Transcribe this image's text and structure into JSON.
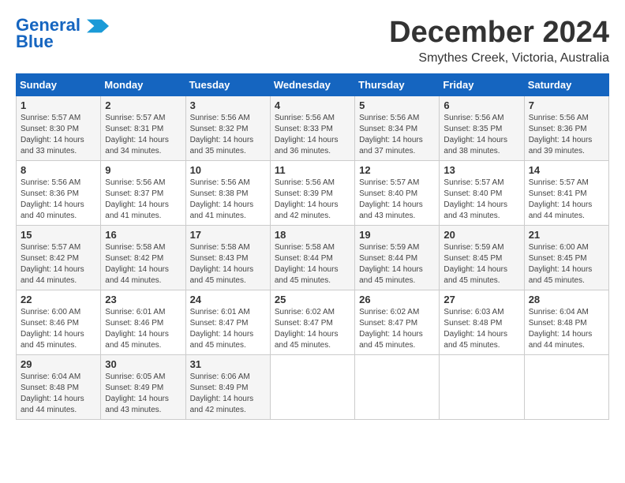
{
  "header": {
    "logo_line1": "General",
    "logo_line2": "Blue",
    "month": "December 2024",
    "location": "Smythes Creek, Victoria, Australia"
  },
  "weekdays": [
    "Sunday",
    "Monday",
    "Tuesday",
    "Wednesday",
    "Thursday",
    "Friday",
    "Saturday"
  ],
  "weeks": [
    [
      {
        "day": "1",
        "sunrise": "5:57 AM",
        "sunset": "8:30 PM",
        "daylight": "14 hours and 33 minutes."
      },
      {
        "day": "2",
        "sunrise": "5:57 AM",
        "sunset": "8:31 PM",
        "daylight": "14 hours and 34 minutes."
      },
      {
        "day": "3",
        "sunrise": "5:56 AM",
        "sunset": "8:32 PM",
        "daylight": "14 hours and 35 minutes."
      },
      {
        "day": "4",
        "sunrise": "5:56 AM",
        "sunset": "8:33 PM",
        "daylight": "14 hours and 36 minutes."
      },
      {
        "day": "5",
        "sunrise": "5:56 AM",
        "sunset": "8:34 PM",
        "daylight": "14 hours and 37 minutes."
      },
      {
        "day": "6",
        "sunrise": "5:56 AM",
        "sunset": "8:35 PM",
        "daylight": "14 hours and 38 minutes."
      },
      {
        "day": "7",
        "sunrise": "5:56 AM",
        "sunset": "8:36 PM",
        "daylight": "14 hours and 39 minutes."
      }
    ],
    [
      {
        "day": "8",
        "sunrise": "5:56 AM",
        "sunset": "8:36 PM",
        "daylight": "14 hours and 40 minutes."
      },
      {
        "day": "9",
        "sunrise": "5:56 AM",
        "sunset": "8:37 PM",
        "daylight": "14 hours and 41 minutes."
      },
      {
        "day": "10",
        "sunrise": "5:56 AM",
        "sunset": "8:38 PM",
        "daylight": "14 hours and 41 minutes."
      },
      {
        "day": "11",
        "sunrise": "5:56 AM",
        "sunset": "8:39 PM",
        "daylight": "14 hours and 42 minutes."
      },
      {
        "day": "12",
        "sunrise": "5:57 AM",
        "sunset": "8:40 PM",
        "daylight": "14 hours and 43 minutes."
      },
      {
        "day": "13",
        "sunrise": "5:57 AM",
        "sunset": "8:40 PM",
        "daylight": "14 hours and 43 minutes."
      },
      {
        "day": "14",
        "sunrise": "5:57 AM",
        "sunset": "8:41 PM",
        "daylight": "14 hours and 44 minutes."
      }
    ],
    [
      {
        "day": "15",
        "sunrise": "5:57 AM",
        "sunset": "8:42 PM",
        "daylight": "14 hours and 44 minutes."
      },
      {
        "day": "16",
        "sunrise": "5:58 AM",
        "sunset": "8:42 PM",
        "daylight": "14 hours and 44 minutes."
      },
      {
        "day": "17",
        "sunrise": "5:58 AM",
        "sunset": "8:43 PM",
        "daylight": "14 hours and 45 minutes."
      },
      {
        "day": "18",
        "sunrise": "5:58 AM",
        "sunset": "8:44 PM",
        "daylight": "14 hours and 45 minutes."
      },
      {
        "day": "19",
        "sunrise": "5:59 AM",
        "sunset": "8:44 PM",
        "daylight": "14 hours and 45 minutes."
      },
      {
        "day": "20",
        "sunrise": "5:59 AM",
        "sunset": "8:45 PM",
        "daylight": "14 hours and 45 minutes."
      },
      {
        "day": "21",
        "sunrise": "6:00 AM",
        "sunset": "8:45 PM",
        "daylight": "14 hours and 45 minutes."
      }
    ],
    [
      {
        "day": "22",
        "sunrise": "6:00 AM",
        "sunset": "8:46 PM",
        "daylight": "14 hours and 45 minutes."
      },
      {
        "day": "23",
        "sunrise": "6:01 AM",
        "sunset": "8:46 PM",
        "daylight": "14 hours and 45 minutes."
      },
      {
        "day": "24",
        "sunrise": "6:01 AM",
        "sunset": "8:47 PM",
        "daylight": "14 hours and 45 minutes."
      },
      {
        "day": "25",
        "sunrise": "6:02 AM",
        "sunset": "8:47 PM",
        "daylight": "14 hours and 45 minutes."
      },
      {
        "day": "26",
        "sunrise": "6:02 AM",
        "sunset": "8:47 PM",
        "daylight": "14 hours and 45 minutes."
      },
      {
        "day": "27",
        "sunrise": "6:03 AM",
        "sunset": "8:48 PM",
        "daylight": "14 hours and 45 minutes."
      },
      {
        "day": "28",
        "sunrise": "6:04 AM",
        "sunset": "8:48 PM",
        "daylight": "14 hours and 44 minutes."
      }
    ],
    [
      {
        "day": "29",
        "sunrise": "6:04 AM",
        "sunset": "8:48 PM",
        "daylight": "14 hours and 44 minutes."
      },
      {
        "day": "30",
        "sunrise": "6:05 AM",
        "sunset": "8:49 PM",
        "daylight": "14 hours and 43 minutes."
      },
      {
        "day": "31",
        "sunrise": "6:06 AM",
        "sunset": "8:49 PM",
        "daylight": "14 hours and 42 minutes."
      },
      null,
      null,
      null,
      null
    ]
  ]
}
